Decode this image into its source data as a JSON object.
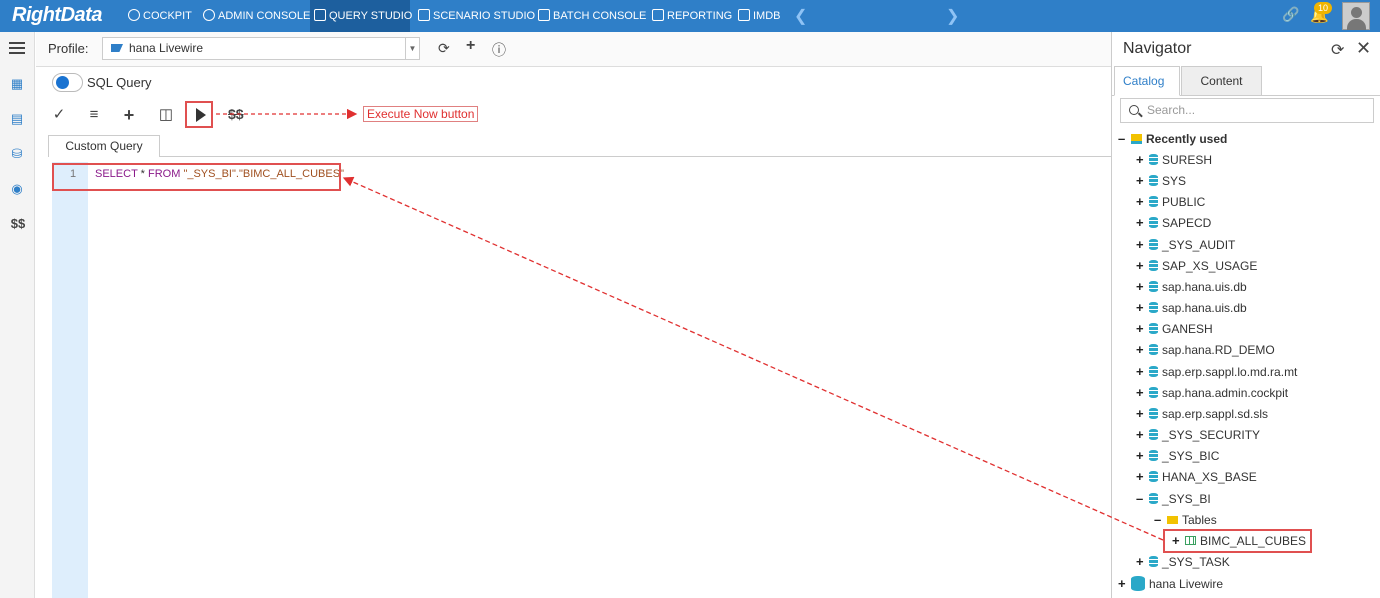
{
  "topnav": {
    "logo": "RightData",
    "items": [
      {
        "label": "COCKPIT",
        "icon": "dashboard-icon"
      },
      {
        "label": "ADMIN CONSOLE",
        "icon": "gear-icon"
      },
      {
        "label": "QUERY STUDIO",
        "icon": "database-icon",
        "active": true
      },
      {
        "label": "SCENARIO STUDIO",
        "icon": "scenario-icon"
      },
      {
        "label": "BATCH CONSOLE",
        "icon": "batch-icon"
      },
      {
        "label": "REPORTING",
        "icon": "report-icon"
      },
      {
        "label": "IMDB",
        "icon": "imdb-icon"
      }
    ],
    "notifications": "10"
  },
  "leftbar": {
    "dollar": "$$"
  },
  "profile": {
    "label": "Profile:",
    "value": "hana Livewire"
  },
  "sql_toggle_label": "SQL Query",
  "toolbar": {
    "dollar": "$$"
  },
  "annotation": {
    "execute": "Execute Now button"
  },
  "editor": {
    "tab": "Custom Query",
    "line_no": "1",
    "code": {
      "select": "SELECT",
      "star": " * ",
      "from": "FROM",
      "table": " \"_SYS_BI\".\"BIMC_ALL_CUBES\""
    }
  },
  "navigator": {
    "title": "Navigator",
    "tabs": {
      "catalog": "Catalog",
      "content": "Content"
    },
    "search_placeholder": "Search...",
    "recently_used": "Recently used",
    "schemas": [
      "SURESH",
      "SYS",
      "PUBLIC",
      "SAPECD",
      "_SYS_AUDIT",
      "SAP_XS_USAGE",
      "sap.hana.uis.db",
      "sap.hana.uis.db",
      "GANESH",
      "sap.hana.RD_DEMO",
      "sap.erp.sappl.lo.md.ra.mt",
      "sap.hana.admin.cockpit",
      "sap.erp.sappl.sd.sls",
      "_SYS_SECURITY",
      "_SYS_BIC",
      "HANA_XS_BASE"
    ],
    "expanded_schema": "_SYS_BI",
    "tables_folder": "Tables",
    "table": "BIMC_ALL_CUBES",
    "after_schema": "_SYS_TASK",
    "connection": "hana Livewire"
  },
  "colors": {
    "topbar": "#2f7fc8",
    "annotation": "#e03030"
  }
}
